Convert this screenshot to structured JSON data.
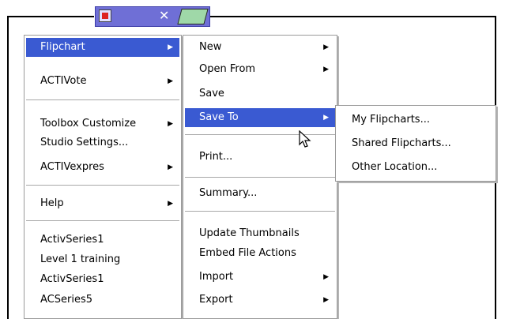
{
  "main_menu": {
    "items": [
      {
        "label": "Flipchart",
        "arrow": "▶",
        "selected": true
      },
      {
        "label": "ACTIVote",
        "arrow": "▶"
      },
      {
        "label": "Toolbox Customize",
        "arrow": "▶"
      },
      {
        "label": "Studio Settings..."
      },
      {
        "label": "ACTIVexpres",
        "arrow": "▶"
      },
      {
        "label": "Help",
        "arrow": "▶"
      },
      {
        "label": "ActivSeries1"
      },
      {
        "label": "Level 1 training"
      },
      {
        "label": "ActivSeries1"
      },
      {
        "label": "ACSeries5"
      }
    ]
  },
  "flipchart_menu": {
    "items": [
      {
        "label": "New",
        "arrow": "▶"
      },
      {
        "label": "Open From",
        "arrow": "▶"
      },
      {
        "label": "Save"
      },
      {
        "label": "Save To",
        "arrow": "▶",
        "selected": true
      },
      {
        "label": "Print..."
      },
      {
        "label": "Summary..."
      },
      {
        "label": "Update Thumbnails"
      },
      {
        "label": "Embed File Actions"
      },
      {
        "label": "Import",
        "arrow": "▶"
      },
      {
        "label": "Export",
        "arrow": "▶"
      }
    ]
  },
  "save_to_menu": {
    "items": [
      {
        "label": "My Flipcharts..."
      },
      {
        "label": "Shared Flipcharts..."
      },
      {
        "label": "Other Location..."
      }
    ]
  },
  "taskbar": {
    "close_glyph": "✕"
  },
  "colors": {
    "selection": "#3a5ad2",
    "taskbar": "#6f6fd6"
  }
}
